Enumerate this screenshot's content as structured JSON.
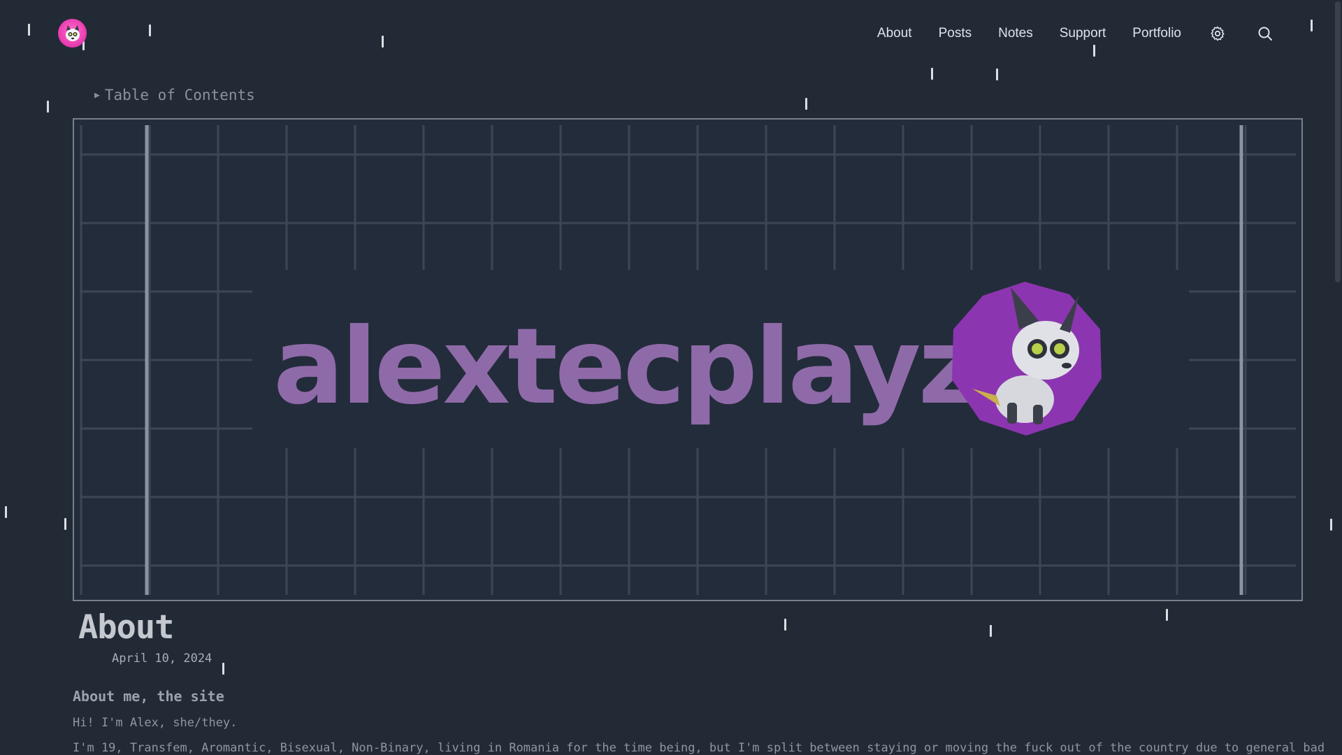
{
  "nav": {
    "items": [
      {
        "label": "About"
      },
      {
        "label": "Posts"
      },
      {
        "label": "Notes"
      },
      {
        "label": "Support"
      },
      {
        "label": "Portfolio"
      }
    ],
    "settings_icon": "gear-icon",
    "search_icon": "search-icon"
  },
  "site": {
    "logo_icon": "alexte-avatar-logo",
    "accent_color": "#ec3fb2"
  },
  "toc": {
    "label": "Table of Contents",
    "marker": "▶"
  },
  "banner": {
    "brand_text": "alextecplayz",
    "text_color": "#8f6aa8",
    "badge_color": "#8c35b0"
  },
  "article": {
    "title": "About",
    "date": "April 10, 2024",
    "subheading": "About me, the site",
    "paragraphs": [
      "Hi! I'm Alex, she/they.",
      "I'm 19, Transfem, Aromantic, Bisexual, Non-Binary, living in Romania for the time being, but I'm split between staying or moving the fuck out of the country due to general bad"
    ]
  }
}
